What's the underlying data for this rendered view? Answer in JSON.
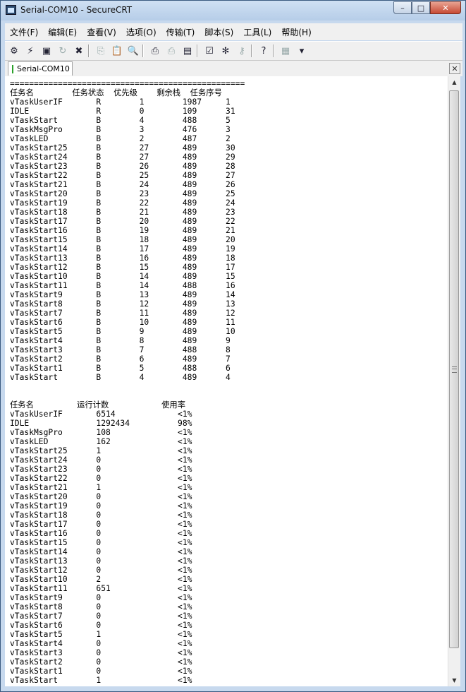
{
  "window": {
    "title": "Serial-COM10 - SecureCRT",
    "min": "–",
    "max": "□",
    "close": "✕"
  },
  "menu": [
    "文件(F)",
    "编辑(E)",
    "查看(V)",
    "选项(O)",
    "传输(T)",
    "脚本(S)",
    "工具(L)",
    "帮助(H)"
  ],
  "toolbar_icons": [
    "connect-icon",
    "quick-connect-icon",
    "connect-tab-icon",
    "reconnect-icon",
    "disconnect-icon",
    "|",
    "copy-icon",
    "paste-icon",
    "find-icon",
    "|",
    "print-icon",
    "print-selection-icon",
    "print-setup-icon",
    "|",
    "session-options-icon",
    "global-options-icon",
    "keymap-icon",
    "|",
    "help-icon",
    "|",
    "command-window-icon",
    "more-icon"
  ],
  "tab": {
    "label": "Serial-COM10",
    "close": "✕"
  },
  "terminal": {
    "separator": "=================================================",
    "task_header": {
      "name": "任务名",
      "state": "任务状态",
      "priority": "优先级",
      "stack": "剩余栈",
      "seq": "任务序号"
    },
    "tasks": [
      [
        "vTaskUserIF",
        "R",
        "1",
        "1987",
        "1"
      ],
      [
        "IDLE",
        "R",
        "0",
        "109",
        "31"
      ],
      [
        "vTaskStart",
        "B",
        "4",
        "488",
        "5"
      ],
      [
        "vTaskMsgPro",
        "B",
        "3",
        "476",
        "3"
      ],
      [
        "vTaskLED",
        "B",
        "2",
        "487",
        "2"
      ],
      [
        "vTaskStart25",
        "B",
        "27",
        "489",
        "30"
      ],
      [
        "vTaskStart24",
        "B",
        "27",
        "489",
        "29"
      ],
      [
        "vTaskStart23",
        "B",
        "26",
        "489",
        "28"
      ],
      [
        "vTaskStart22",
        "B",
        "25",
        "489",
        "27"
      ],
      [
        "vTaskStart21",
        "B",
        "24",
        "489",
        "26"
      ],
      [
        "vTaskStart20",
        "B",
        "23",
        "489",
        "25"
      ],
      [
        "vTaskStart19",
        "B",
        "22",
        "489",
        "24"
      ],
      [
        "vTaskStart18",
        "B",
        "21",
        "489",
        "23"
      ],
      [
        "vTaskStart17",
        "B",
        "20",
        "489",
        "22"
      ],
      [
        "vTaskStart16",
        "B",
        "19",
        "489",
        "21"
      ],
      [
        "vTaskStart15",
        "B",
        "18",
        "489",
        "20"
      ],
      [
        "vTaskStart14",
        "B",
        "17",
        "489",
        "19"
      ],
      [
        "vTaskStart13",
        "B",
        "16",
        "489",
        "18"
      ],
      [
        "vTaskStart12",
        "B",
        "15",
        "489",
        "17"
      ],
      [
        "vTaskStart10",
        "B",
        "14",
        "489",
        "15"
      ],
      [
        "vTaskStart11",
        "B",
        "14",
        "488",
        "16"
      ],
      [
        "vTaskStart9",
        "B",
        "13",
        "489",
        "14"
      ],
      [
        "vTaskStart8",
        "B",
        "12",
        "489",
        "13"
      ],
      [
        "vTaskStart7",
        "B",
        "11",
        "489",
        "12"
      ],
      [
        "vTaskStart6",
        "B",
        "10",
        "489",
        "11"
      ],
      [
        "vTaskStart5",
        "B",
        "9",
        "489",
        "10"
      ],
      [
        "vTaskStart4",
        "B",
        "8",
        "489",
        "9"
      ],
      [
        "vTaskStart3",
        "B",
        "7",
        "488",
        "8"
      ],
      [
        "vTaskStart2",
        "B",
        "6",
        "489",
        "7"
      ],
      [
        "vTaskStart1",
        "B",
        "5",
        "488",
        "6"
      ],
      [
        "vTaskStart",
        "B",
        "4",
        "489",
        "4"
      ]
    ],
    "run_header": {
      "name": "任务名",
      "count": "运行计数",
      "usage": "使用率"
    },
    "runs": [
      [
        "vTaskUserIF",
        "6514",
        "<1%"
      ],
      [
        "IDLE",
        "1292434",
        "98%"
      ],
      [
        "vTaskMsgPro",
        "108",
        "<1%"
      ],
      [
        "vTaskLED",
        "162",
        "<1%"
      ],
      [
        "vTaskStart25",
        "1",
        "<1%"
      ],
      [
        "vTaskStart24",
        "0",
        "<1%"
      ],
      [
        "vTaskStart23",
        "0",
        "<1%"
      ],
      [
        "vTaskStart22",
        "0",
        "<1%"
      ],
      [
        "vTaskStart21",
        "1",
        "<1%"
      ],
      [
        "vTaskStart20",
        "0",
        "<1%"
      ],
      [
        "vTaskStart19",
        "0",
        "<1%"
      ],
      [
        "vTaskStart18",
        "0",
        "<1%"
      ],
      [
        "vTaskStart17",
        "0",
        "<1%"
      ],
      [
        "vTaskStart16",
        "0",
        "<1%"
      ],
      [
        "vTaskStart15",
        "0",
        "<1%"
      ],
      [
        "vTaskStart14",
        "0",
        "<1%"
      ],
      [
        "vTaskStart13",
        "0",
        "<1%"
      ],
      [
        "vTaskStart12",
        "0",
        "<1%"
      ],
      [
        "vTaskStart10",
        "2",
        "<1%"
      ],
      [
        "vTaskStart11",
        "651",
        "<1%"
      ],
      [
        "vTaskStart9",
        "0",
        "<1%"
      ],
      [
        "vTaskStart8",
        "0",
        "<1%"
      ],
      [
        "vTaskStart7",
        "0",
        "<1%"
      ],
      [
        "vTaskStart6",
        "0",
        "<1%"
      ],
      [
        "vTaskStart5",
        "1",
        "<1%"
      ],
      [
        "vTaskStart4",
        "0",
        "<1%"
      ],
      [
        "vTaskStart3",
        "0",
        "<1%"
      ],
      [
        "vTaskStart2",
        "0",
        "<1%"
      ],
      [
        "vTaskStart1",
        "0",
        "<1%"
      ],
      [
        "vTaskStart",
        "1",
        "<1%"
      ]
    ]
  }
}
